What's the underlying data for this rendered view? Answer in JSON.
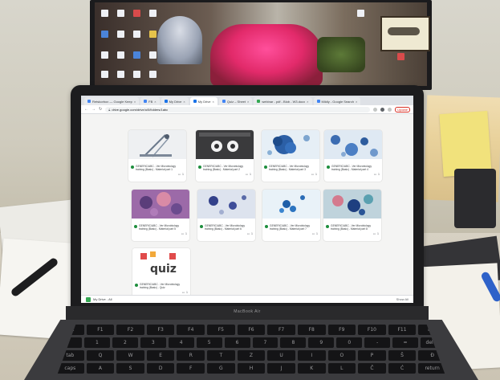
{
  "browser": {
    "tabs": [
      {
        "label": "Retskorbox — Google Keep",
        "active": false,
        "favicon": "g"
      },
      {
        "label": "FB",
        "active": false,
        "favicon": "g"
      },
      {
        "label": "My Drive",
        "active": false,
        "favicon": "g"
      },
      {
        "label": "My Drive",
        "active": true,
        "favicon": "g"
      },
      {
        "label": "Quiz – Sheet",
        "active": false,
        "favicon": "g"
      },
      {
        "label": "webinar - pdf - Blob - W3.docx",
        "active": false,
        "favicon": "gr"
      },
      {
        "label": "Mildly - Google Search",
        "active": false,
        "favicon": "g"
      }
    ],
    "omnibox_url": "drive.google.com/drive/u/0/folders/1abc",
    "update_label": "Update"
  },
  "drive": {
    "cards": [
      {
        "title": "GENERIC/ABC - Ver Microbiology training (Basic) - Material part 1",
        "comments": "1",
        "thumb": "lab"
      },
      {
        "title": "GENERIC/ABC - Ver Microbiology training (Basic) - Material part 2",
        "comments": "1",
        "thumb": "video"
      },
      {
        "title": "GENERIC/ABC - Ver Microbiology training (Basic) - Material part 3",
        "comments": "1",
        "thumb": "cyto1"
      },
      {
        "title": "GENERIC/ABC - Ver Microbiology training (Basic) - Material part 4",
        "comments": "1",
        "thumb": "cyto2"
      },
      {
        "title": "GENERIC/ABC - Ver Microbiology training (Basic) - Material part 5",
        "comments": "1",
        "thumb": "cyto3"
      },
      {
        "title": "GENERIC/ABC - Ver Microbiology training (Basic) - Material part 6",
        "comments": "1",
        "thumb": "cyto4"
      },
      {
        "title": "GENERIC/ABC - Ver Microbiology training (Basic) - Material part 7",
        "comments": "1",
        "thumb": "cyto5"
      },
      {
        "title": "GENERIC/ABC - Ver Microbiology training (Basic) - Material part 8",
        "comments": "1",
        "thumb": "cyto6"
      },
      {
        "title": "GENERIC/ABC - Ver Microbiology training (Basic) - Quiz",
        "comments": "1",
        "thumb": "quiz"
      }
    ],
    "quiz_thumb_text": "quiz"
  },
  "statusbar": {
    "file_label": "My Drive - All",
    "right_label": "Show All"
  },
  "laptop": {
    "brand": "MacBook Air"
  },
  "keyboard": {
    "row1": [
      "esc",
      "F1",
      "F2",
      "F3",
      "F4",
      "F5",
      "F6",
      "F7",
      "F8",
      "F9",
      "F10",
      "F11",
      "F12"
    ],
    "row2": [
      "`",
      "1",
      "2",
      "3",
      "4",
      "5",
      "6",
      "7",
      "8",
      "9",
      "0",
      "-",
      "=",
      "delete"
    ],
    "row3": [
      "tab",
      "Q",
      "W",
      "E",
      "R",
      "T",
      "Z",
      "U",
      "I",
      "O",
      "P",
      "Š",
      "Đ"
    ],
    "row4": [
      "caps",
      "A",
      "S",
      "D",
      "F",
      "G",
      "H",
      "J",
      "K",
      "L",
      "Č",
      "Ć",
      "return"
    ]
  }
}
